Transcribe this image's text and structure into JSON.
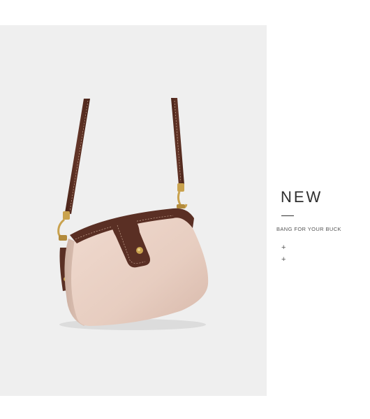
{
  "product": {
    "image_alt": "Pink canvas doctor-style crossbody bag with brown leather strap and flap",
    "colors": {
      "background": "#efefef",
      "bag_body": "#e8cfc3",
      "leather": "#5a2f24",
      "hardware": "#c9a24e"
    }
  },
  "info": {
    "title": "NEW",
    "tagline": "BANG FOR YOUR BUCK",
    "expand_1": "+",
    "expand_2": "+"
  }
}
